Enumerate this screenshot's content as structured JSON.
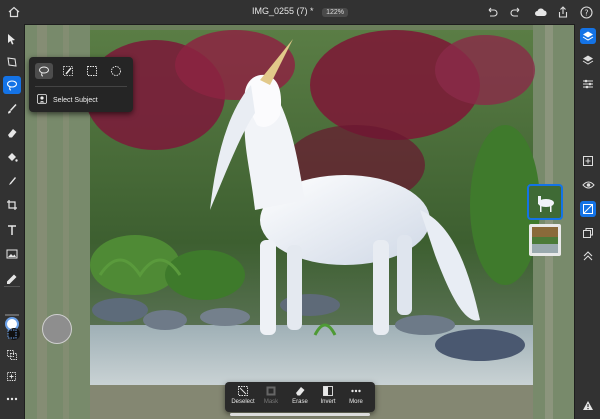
{
  "header": {
    "doc_title": "IMG_0255 (7) *",
    "zoom": "122%",
    "icons": [
      "home-icon",
      "undo-icon",
      "redo-icon",
      "cloud-icon",
      "share-icon",
      "help-icon"
    ]
  },
  "left_toolbar": {
    "tools": [
      "move-tool",
      "transform-tool",
      "select-tool",
      "brush-tool",
      "eraser-tool",
      "fill-tool",
      "heal-tool",
      "crop-tool",
      "type-tool",
      "place-image-tool",
      "eyedropper-tool"
    ],
    "active": "select-tool",
    "colors": {
      "foreground": "#ffffff",
      "background": "#111111"
    }
  },
  "select_flyout": {
    "modes": [
      "lasso-select",
      "brush-select",
      "marquee-select",
      "ellipse-select"
    ],
    "active_mode": "lasso-select",
    "select_subject_label": "Select Subject"
  },
  "right_toolbar": {
    "tools": [
      "layers-icon",
      "layer-properties-icon",
      "adjustments-icon",
      "add-layer-icon",
      "visibility-icon",
      "mask-icon",
      "arrange-icon",
      "more-icon",
      "warning-icon"
    ],
    "active": "layers-icon"
  },
  "task_bar": {
    "items": [
      {
        "label": "Deselect",
        "enabled": true
      },
      {
        "label": "Mask",
        "enabled": false
      },
      {
        "label": "Erase",
        "enabled": true
      },
      {
        "label": "Invert",
        "enabled": true
      },
      {
        "label": "More",
        "enabled": true
      }
    ]
  },
  "colors": {
    "accent": "#1473e6",
    "panel": "#323232",
    "canvas_bg": "#2b2b2b"
  }
}
